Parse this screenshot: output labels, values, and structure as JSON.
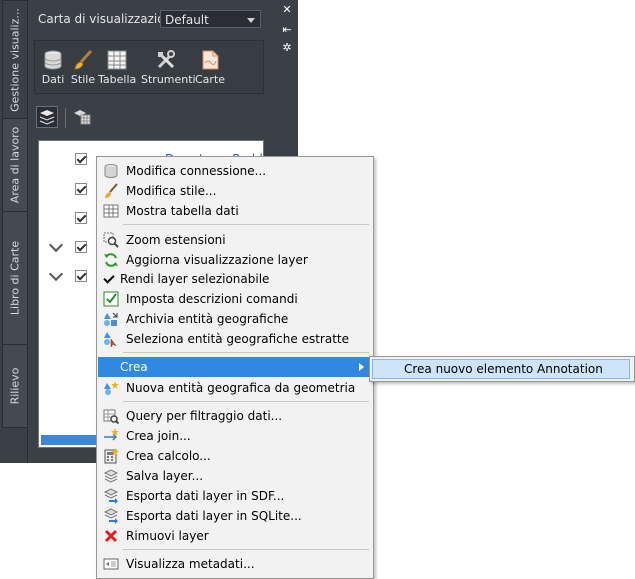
{
  "palette": {
    "tabs": [
      "Gestione visualiz...",
      "Area di lavoro",
      "Libro di Carte",
      "Rilievo"
    ],
    "map_label": "Carta di visualizzazione:",
    "map_select_value": "Default",
    "toolbar": [
      {
        "label": "Dati",
        "icon": "database-icon"
      },
      {
        "label": "Stile",
        "icon": "brush-icon"
      },
      {
        "label": "Tabella",
        "icon": "table-icon"
      },
      {
        "label": "Strumenti",
        "icon": "tools-icon"
      },
      {
        "label": "Carte",
        "icon": "map-sheet-icon"
      }
    ],
    "layers": [
      {
        "label": "Downtown Redd...",
        "checked": true
      },
      {
        "checked": true
      },
      {
        "checked": true
      },
      {
        "checked": true,
        "expanded": true
      },
      {
        "checked": true,
        "expanded": true
      }
    ]
  },
  "context_menu": {
    "items": [
      {
        "label": "Modifica connessione...",
        "icon": "database-icon"
      },
      {
        "label": "Modifica stile...",
        "icon": "brush-icon"
      },
      {
        "label": "Mostra tabella dati",
        "icon": "table-icon"
      },
      {
        "label": "Zoom estensioni",
        "icon": "zoom-extents-icon"
      },
      {
        "label": "Aggiorna visualizzazione layer",
        "icon": "refresh-icon"
      },
      {
        "label": "Rendi layer selezionabile",
        "icon": "checkmark-icon",
        "checked": true
      },
      {
        "label": "Imposta descrizioni comandi",
        "icon": "tooltip-check-icon"
      },
      {
        "label": "Archivia entità geografiche",
        "icon": "checkin-features-icon"
      },
      {
        "label": "Seleziona entità geografiche estratte",
        "icon": "select-checked-out-icon"
      },
      {
        "label": "Crea",
        "icon": "",
        "submenu": true,
        "highlighted": true
      },
      {
        "label": "Nuova entità geografica da geometria",
        "icon": "new-feature-icon"
      },
      {
        "label": "Query per filtraggio dati...",
        "icon": "query-filter-icon"
      },
      {
        "label": "Crea join...",
        "icon": "join-icon"
      },
      {
        "label": "Crea calcolo...",
        "icon": "calculator-icon"
      },
      {
        "label": "Salva layer...",
        "icon": "save-layer-icon"
      },
      {
        "label": "Esporta dati layer in SDF...",
        "icon": "export-sdf-icon"
      },
      {
        "label": "Esporta dati layer in SQLite...",
        "icon": "export-sqlite-icon"
      },
      {
        "label": "Rimuovi layer",
        "icon": "remove-icon"
      },
      {
        "label": "Visualizza metadati...",
        "icon": "metadata-icon"
      }
    ]
  },
  "submenu": {
    "items": [
      {
        "label": "Crea nuovo elemento Annotation"
      }
    ]
  },
  "colors": {
    "palette_bg": "#3b3f46",
    "menu_bg": "#f2f2f2",
    "highlight": "#3088e0",
    "submenu_highlight": "#cde4fb"
  }
}
